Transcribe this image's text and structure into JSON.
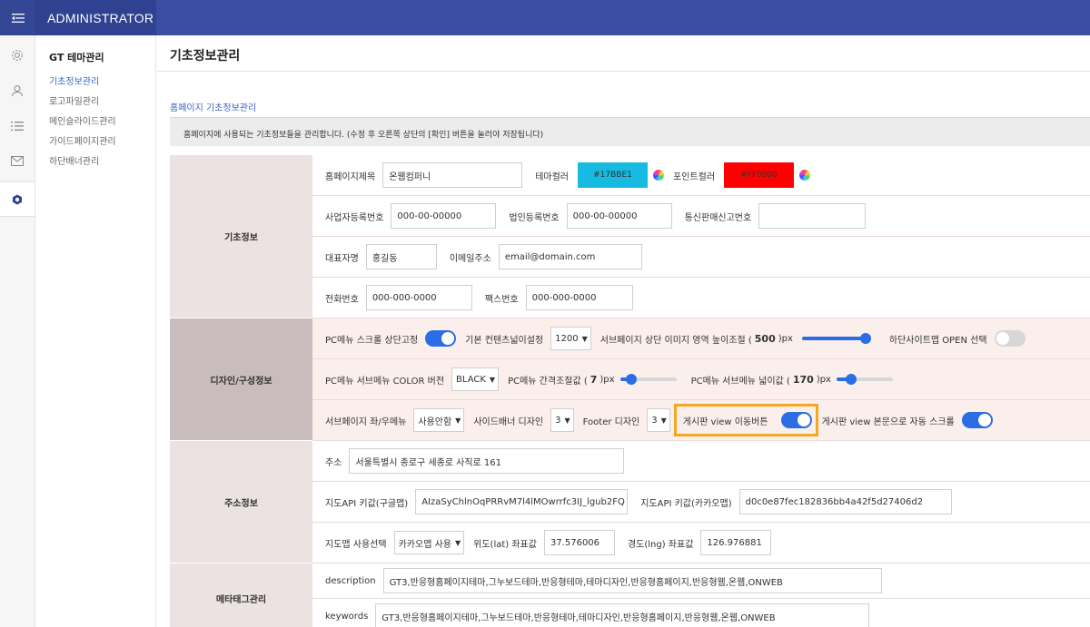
{
  "header": {
    "brand": "ADMINISTRATOR"
  },
  "rail": {
    "icons": [
      "settings-icon",
      "user-icon",
      "list-icon",
      "mail-icon",
      "gt-theme-icon"
    ]
  },
  "submenu": {
    "title": "GT 테마관리",
    "items": [
      {
        "label": "기초정보관리",
        "active": true
      },
      {
        "label": "로고파일관리",
        "active": false
      },
      {
        "label": "메인슬라이드관리",
        "active": false
      },
      {
        "label": "가이드페이지관리",
        "active": false
      },
      {
        "label": "하단배너관리",
        "active": false
      }
    ]
  },
  "page": {
    "title": "기초정보관리",
    "section_title": "홈페이지 기초정보관리",
    "notice": "홈페이지에 사용되는 기초정보들을 관리합니다. (수정 후 오른쪽 상단의 [확인] 버튼을 눌러야 저장됩니다)"
  },
  "basic": {
    "label": "기초정보",
    "site_name_label": "홈페이지제목",
    "site_name": "온웹컴퍼니",
    "theme_color_label": "테마컬러",
    "theme_color": "#17BBE1",
    "point_color_label": "포인트컬러",
    "point_color": "#FF0000",
    "biz_no_label": "사업자등록번호",
    "biz_no": "000-00-00000",
    "corp_no_label": "법인등록번호",
    "corp_no": "000-00-00000",
    "mail_order_label": "통신판매신고번호",
    "mail_order": "",
    "ceo_label": "대표자명",
    "ceo": "홍길동",
    "email_label": "이메일주소",
    "email": "email@domain.com",
    "phone_label": "전화번호",
    "phone": "000-000-0000",
    "fax_label": "팩스번호",
    "fax": "000-000-0000"
  },
  "design": {
    "label": "디자인/구성정보",
    "pc_scroll_fix_label": "PC메뉴 스크롤 상단고정",
    "pc_scroll_fix": true,
    "content_width_label": "기본 컨텐츠넓이설정",
    "content_width": "1200",
    "sub_height_label_pre": "서브페이지 상단 이미지 영역 높이조절 (",
    "sub_height": "500",
    "sub_height_unit": ")px",
    "sub_height_level": 1.0,
    "sitemap_label": "하단사이트맵 OPEN 선택",
    "sitemap_open": false,
    "submenu_color_label": "PC메뉴 서브메뉴 COLOR 버전",
    "submenu_color": "BLACK",
    "menu_gap_label_pre": "PC메뉴 간격조절값 (",
    "menu_gap": "7",
    "menu_gap_unit": ")px",
    "menu_gap_level": 0.12,
    "submenu_width_label_pre": "PC메뉴 서브메뉴 넓이값 (",
    "submenu_width": "170",
    "submenu_width_unit": ")px",
    "submenu_width_level": 0.2,
    "side_menu_label": "서브페이지 좌/우메뉴",
    "side_menu": "사용안함",
    "side_banner_label": "사이드배너 디자인",
    "side_banner": "3",
    "footer_design_label": "Footer 디자인",
    "footer_design": "3",
    "board_nav_label": "게시판 view 이동버튼",
    "board_nav": true,
    "board_autoscroll_label": "게시판 view 본문으로 자동 스크롤",
    "board_autoscroll": true
  },
  "address": {
    "label": "주소정보",
    "addr_label": "주소",
    "addr": "서울특별시 종로구 세종로 사직로 161",
    "google_key_label": "지도API 키값(구글맵)",
    "google_key": "AIzaSyChlnOqPRRvM7l4lMOwrrfc3IJ_lgub2FQ",
    "kakao_key_label": "지도API 키값(카카오맵)",
    "kakao_key": "d0c0e87fec182836bb4a42f5d27406d2",
    "map_select_label": "지도맵 사용선택",
    "map_select": "카카오맵 사용",
    "lat_label": "위도(lat) 좌표값",
    "lat": "37.576006",
    "lng_label": "경도(lng) 좌표값",
    "lng": "126.976881"
  },
  "meta": {
    "label": "메타태그관리",
    "desc_label": "description",
    "desc": "GT3,반응형홈페이지테마,그누보드테마,반응형테마,테마디자인,반응형홈페이지,반응형웹,온웹,ONWEB",
    "keywords_label": "keywords",
    "keywords": "GT3,반응형홈페이지테마,그누보드테마,반응형테마,테마디자인,반응형홈페이지,반응형웹,온웹,ONWEB"
  }
}
